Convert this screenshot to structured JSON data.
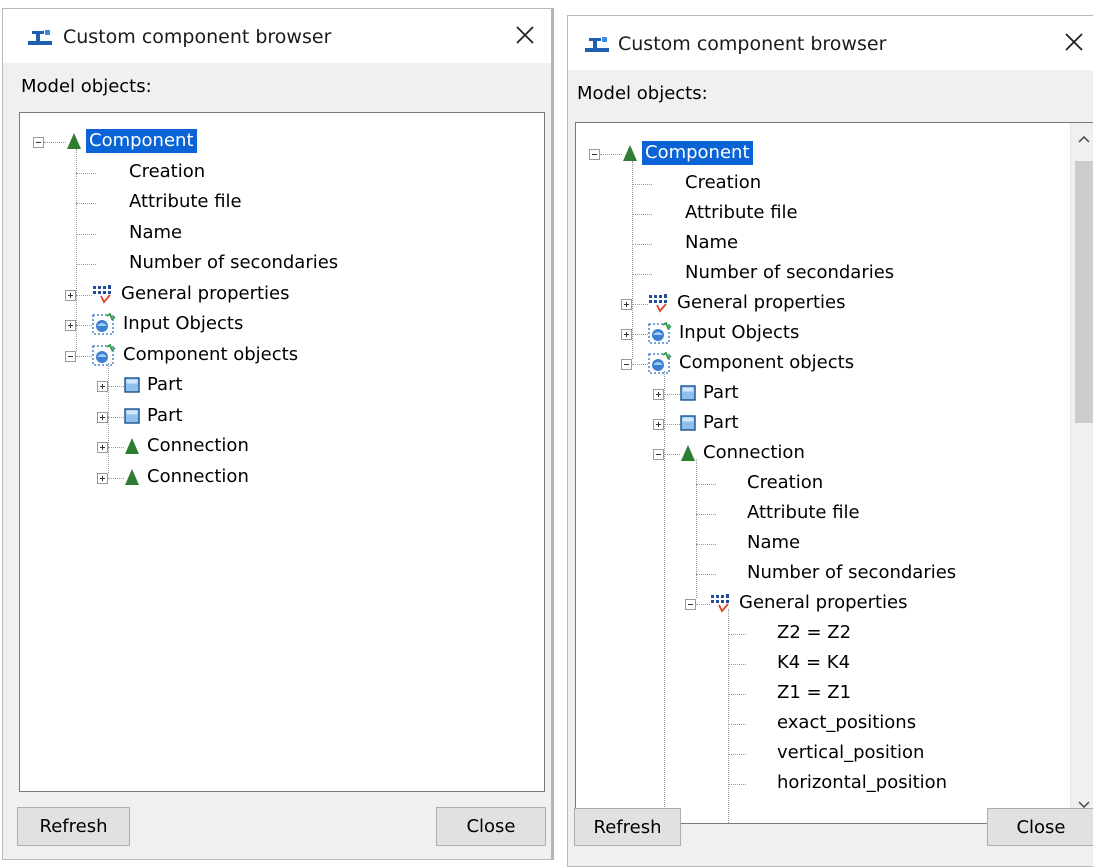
{
  "windows": [
    {
      "id": "left",
      "title": "Custom component browser",
      "model_objects_label": "Model objects:",
      "buttons": {
        "refresh": "Refresh",
        "close": "Close"
      },
      "tree": [
        {
          "label": "Component",
          "icon": "component-triangle-icon",
          "selected": true
        },
        {
          "label": "Creation"
        },
        {
          "label": "Attribute file"
        },
        {
          "label": "Name"
        },
        {
          "label": "Number of secondaries"
        },
        {
          "label": "General properties",
          "icon": "general-properties-icon"
        },
        {
          "label": "Input Objects",
          "icon": "input-objects-icon"
        },
        {
          "label": "Component objects",
          "icon": "component-objects-icon"
        },
        {
          "label": "Part",
          "icon": "part-icon"
        },
        {
          "label": "Part",
          "icon": "part-icon"
        },
        {
          "label": "Connection",
          "icon": "connection-triangle-icon"
        },
        {
          "label": "Connection",
          "icon": "connection-triangle-icon"
        }
      ]
    },
    {
      "id": "right",
      "title": "Custom component browser",
      "model_objects_label": "Model objects:",
      "buttons": {
        "refresh": "Refresh",
        "close": "Close"
      },
      "tree": [
        {
          "label": "Component",
          "icon": "component-triangle-icon",
          "selected": true
        },
        {
          "label": "Creation"
        },
        {
          "label": "Attribute file"
        },
        {
          "label": "Name"
        },
        {
          "label": "Number of secondaries"
        },
        {
          "label": "General properties",
          "icon": "general-properties-icon"
        },
        {
          "label": "Input Objects",
          "icon": "input-objects-icon"
        },
        {
          "label": "Component objects",
          "icon": "component-objects-icon"
        },
        {
          "label": "Part",
          "icon": "part-icon"
        },
        {
          "label": "Part",
          "icon": "part-icon"
        },
        {
          "label": "Connection",
          "icon": "connection-triangle-icon"
        },
        {
          "label": "Creation"
        },
        {
          "label": "Attribute file"
        },
        {
          "label": "Name"
        },
        {
          "label": "Number of secondaries"
        },
        {
          "label": "General properties",
          "icon": "general-properties-icon"
        },
        {
          "label": "Z2 = Z2"
        },
        {
          "label": "K4 = K4"
        },
        {
          "label": "Z1 = Z1"
        },
        {
          "label": "exact_positions"
        },
        {
          "label": "vertical_position"
        },
        {
          "label": "horizontal_position"
        }
      ]
    }
  ],
  "colors": {
    "selection": "#0a64d6",
    "tree_triangle": "#2e7d32",
    "part_blue": "#5b9bd5"
  }
}
